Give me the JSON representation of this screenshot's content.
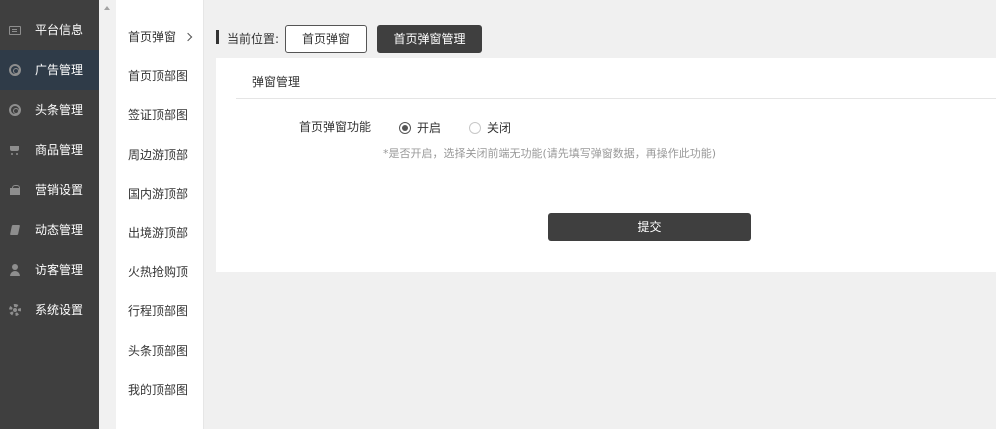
{
  "sidebar": {
    "items": [
      {
        "label": "平台信息",
        "icon": "card-icon"
      },
      {
        "label": "广告管理",
        "icon": "ring-icon"
      },
      {
        "label": "头条管理",
        "icon": "ring-icon"
      },
      {
        "label": "商品管理",
        "icon": "cart-icon"
      },
      {
        "label": "营销设置",
        "icon": "gift-icon"
      },
      {
        "label": "动态管理",
        "icon": "book-icon"
      },
      {
        "label": "访客管理",
        "icon": "user-icon"
      },
      {
        "label": "系统设置",
        "icon": "gear-icon"
      }
    ],
    "active_index": 1
  },
  "submenu": {
    "items": [
      "首页弹窗",
      "首页顶部图",
      "签证顶部图",
      "周边游顶部",
      "国内游顶部",
      "出境游顶部",
      "火热抢购顶",
      "行程顶部图",
      "头条顶部图",
      "我的顶部图"
    ]
  },
  "breadcrumb": {
    "label": "当前位置:",
    "first": "首页弹窗",
    "current": "首页弹窗管理"
  },
  "panel": {
    "title": "弹窗管理",
    "field_label": "首页弹窗功能",
    "option_on": "开启",
    "option_off": "关闭",
    "selected": "开启",
    "hint": "*是否开启，选择关闭前端无功能(请先填写弹窗数据，再操作此功能)",
    "submit_label": "提交"
  }
}
